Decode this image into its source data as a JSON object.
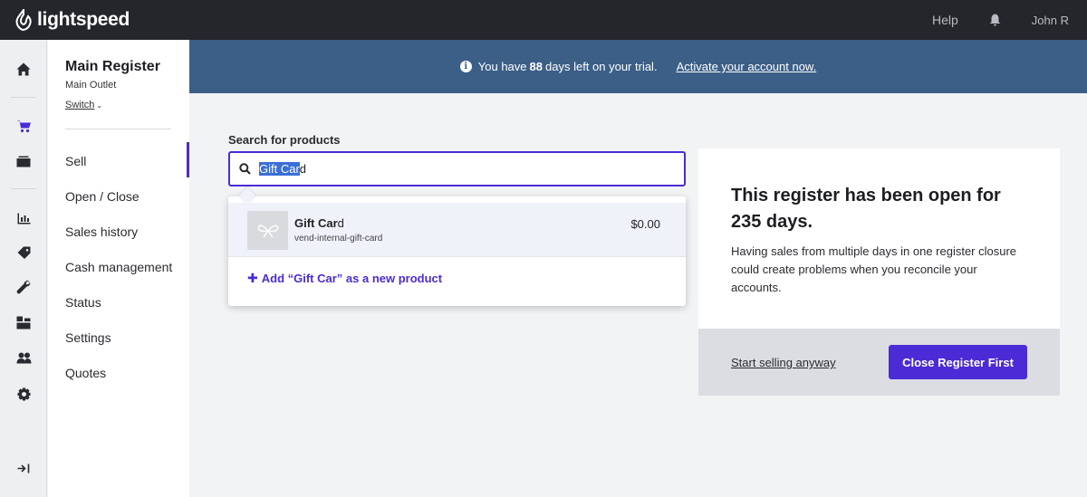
{
  "topbar": {
    "logo_text": "lightspeed",
    "help": "Help",
    "user": "John R"
  },
  "rail": {
    "items": [
      "home-icon",
      "cart-icon",
      "register-icon",
      "reports-icon",
      "tag-icon",
      "wrench-icon",
      "inventory-icon",
      "customers-icon",
      "gear-icon"
    ],
    "active": "cart-icon",
    "collapse_icon": "collapse-icon"
  },
  "register": {
    "title": "Main Register",
    "outlet": "Main Outlet",
    "switch": "Switch"
  },
  "subnav": {
    "items": [
      "Sell",
      "Open / Close",
      "Sales history",
      "Cash management",
      "Status",
      "Settings",
      "Quotes"
    ],
    "active": "Sell"
  },
  "banner": {
    "text_before": "You have",
    "days": "88",
    "text_after": "days left on your trial.",
    "activate": "Activate your account now."
  },
  "search": {
    "label": "Search for products",
    "value_selected": "Gift Car",
    "value_rest": "d"
  },
  "dropdown": {
    "result": {
      "name_match": "Gift Car",
      "name_rest": "d",
      "handle": "vend-internal-gift-card",
      "price": "$0.00"
    },
    "add_new": "Add “Gift Car” as a new product"
  },
  "card": {
    "title": "This register has been open for 235 days.",
    "body": "Having sales from multiple days in one register closure could create problems when you reconcile your accounts.",
    "start_link": "Start selling anyway",
    "close_button": "Close Register First"
  },
  "colors": {
    "accent": "#4b2bd6",
    "banner": "#3b5f87",
    "topbar": "#25262b"
  }
}
